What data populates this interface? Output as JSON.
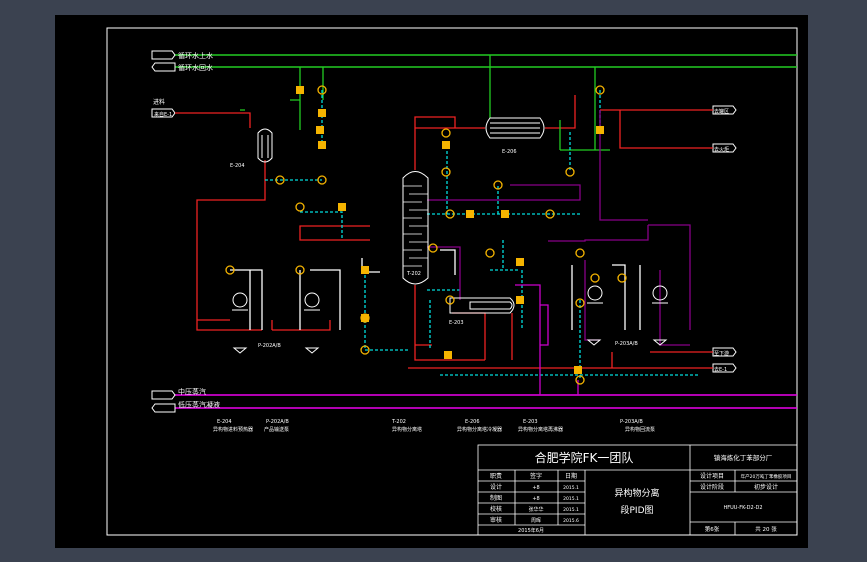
{
  "streams": {
    "cw_supply": "循环水上水",
    "cw_return": "循环水回水",
    "feed": "进料",
    "feed_tag": "来自E-1",
    "mp_steam": "中压蒸汽",
    "lp_condensate": "低压蒸汽凝液",
    "out_top": "去罐区",
    "out_mid": "去火炬",
    "out_bottom1": "至下游",
    "out_bottom2": "去E-1"
  },
  "equipment": [
    {
      "tag": "E-204",
      "name": "异构物进料预热器"
    },
    {
      "tag": "P-202A/B",
      "name": "产品输送泵"
    },
    {
      "tag": "T-202",
      "name": "异构物分离塔"
    },
    {
      "tag": "E-206",
      "name": "异构物分离塔冷凝器"
    },
    {
      "tag": "E-203",
      "name": "异构物分离塔再沸器"
    },
    {
      "tag": "P-203A/B",
      "name": "异构物回流泵"
    }
  ],
  "diagram_labels": {
    "column": "T-202",
    "condenser": "E-206",
    "reboiler": "E-203",
    "preheater": "E-204",
    "pump1": "P-202A/B",
    "pump2": "P-203A/B"
  },
  "title_block": {
    "school": "合肥学院FK一团队",
    "company": "镇海炼化丁苯部分厂",
    "drawing_title_1": "异构物分离",
    "drawing_title_2": "段PID图",
    "headers": [
      "职责",
      "签字",
      "日期"
    ],
    "rows": [
      {
        "role": "设计",
        "sign": "+8",
        "date": "2015.1"
      },
      {
        "role": "制图",
        "sign": "+8",
        "date": "2015.1"
      },
      {
        "role": "校核",
        "sign": "张华华",
        "date": "2015.1"
      },
      {
        "role": "审核",
        "sign": "周晖",
        "date": "2015.6"
      }
    ],
    "date_footer": "2015年6月",
    "project_label": "设计项目",
    "project_value": "年产20万吨丁苯橡胶项目",
    "stage_label": "设计阶段",
    "stage_value": "初步设计",
    "drawing_no": "HFUU-FK-D2-D2",
    "sheet_no": "第6张",
    "sheet_total": "共 20 张"
  }
}
